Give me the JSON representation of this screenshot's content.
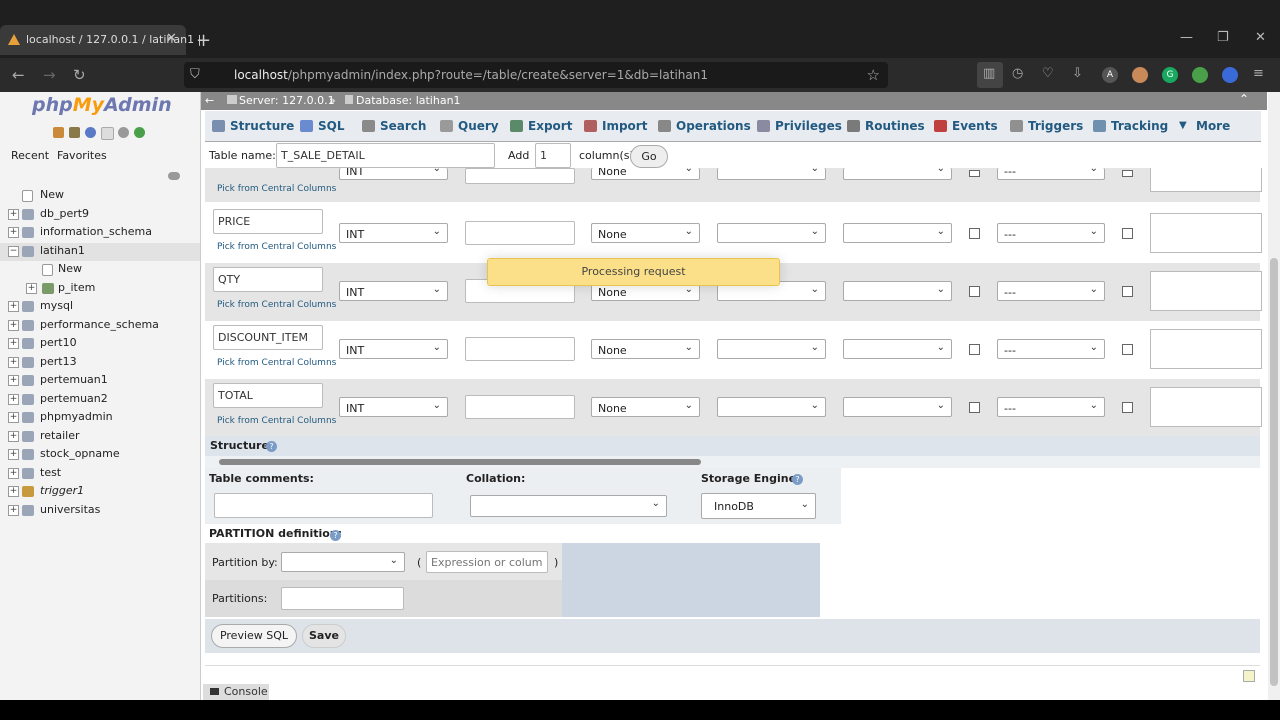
{
  "browser": {
    "tab_title": "localhost / 127.0.0.1 / latihan1 |",
    "url_host": "localhost",
    "url_path": "/phpmyadmin/index.php?route=/table/create&server=1&db=latihan1",
    "extensions": [
      "A",
      "G"
    ]
  },
  "sidebar": {
    "logo_php": "php",
    "logo_my": "My",
    "logo_admin": "Admin",
    "recent": "Recent",
    "favorites": "Favorites",
    "tree": [
      {
        "label": "New",
        "type": "new"
      },
      {
        "label": "db_pert9",
        "type": "db"
      },
      {
        "label": "information_schema",
        "type": "db"
      },
      {
        "label": "latihan1",
        "type": "db",
        "selected": true
      },
      {
        "label": "New",
        "type": "child-new"
      },
      {
        "label": "p_item",
        "type": "child-table"
      },
      {
        "label": "mysql",
        "type": "db"
      },
      {
        "label": "performance_schema",
        "type": "db"
      },
      {
        "label": "pert10",
        "type": "db"
      },
      {
        "label": "pert13",
        "type": "db"
      },
      {
        "label": "pertemuan1",
        "type": "db"
      },
      {
        "label": "pertemuan2",
        "type": "db"
      },
      {
        "label": "phpmyadmin",
        "type": "db"
      },
      {
        "label": "retailer",
        "type": "db"
      },
      {
        "label": "stock_opname",
        "type": "db"
      },
      {
        "label": "test",
        "type": "db"
      },
      {
        "label": "trigger1",
        "type": "db",
        "italic": true
      },
      {
        "label": "universitas",
        "type": "db"
      }
    ]
  },
  "breadcrumb": {
    "server": "Server: 127.0.0.1",
    "sep": "»",
    "database": "Database: latihan1"
  },
  "menu": [
    {
      "label": "Structure",
      "icon": "structure-icon",
      "color": "#7a8fb0"
    },
    {
      "label": "SQL",
      "icon": "sql-icon",
      "color": "#6a8bd0"
    },
    {
      "label": "Search",
      "icon": "search-icon",
      "color": "#8a8a8a"
    },
    {
      "label": "Query",
      "icon": "query-icon",
      "color": "#9a9a9a"
    },
    {
      "label": "Export",
      "icon": "export-icon",
      "color": "#5b8a6a"
    },
    {
      "label": "Import",
      "icon": "import-icon",
      "color": "#b06060"
    },
    {
      "label": "Operations",
      "icon": "wrench-icon",
      "color": "#888888"
    },
    {
      "label": "Privileges",
      "icon": "privileges-icon",
      "color": "#8a8aa0"
    },
    {
      "label": "Routines",
      "icon": "routines-icon",
      "color": "#7a7a7a"
    },
    {
      "label": "Events",
      "icon": "events-icon",
      "color": "#c04040"
    },
    {
      "label": "Triggers",
      "icon": "triggers-icon",
      "color": "#909090"
    },
    {
      "label": "Tracking",
      "icon": "tracking-icon",
      "color": "#7090b0"
    },
    {
      "label": "More",
      "icon": "chevron-down-icon",
      "color": "#235a81"
    }
  ],
  "table_form": {
    "name_label": "Table name:",
    "name_value": "T_SALE_DETAIL",
    "add_label": "Add",
    "add_value": "1",
    "columns_label": "column(s)",
    "go_label": "Go"
  },
  "columns": [
    {
      "name": "",
      "type": "INT",
      "default": "None",
      "index": "---"
    },
    {
      "name": "PRICE",
      "type": "INT",
      "default": "None",
      "index": "---"
    },
    {
      "name": "QTY",
      "type": "INT",
      "default": "None",
      "index": "---"
    },
    {
      "name": "DISCOUNT_ITEM",
      "type": "INT",
      "default": "None",
      "index": "---"
    },
    {
      "name": "TOTAL",
      "type": "INT",
      "default": "None",
      "index": "---"
    }
  ],
  "pick_central": "Pick from Central Columns",
  "toast": "Processing request",
  "structure_heading": "Structure",
  "table_comments_label": "Table comments:",
  "collation_label": "Collation:",
  "storage_engine_label": "Storage Engine:",
  "storage_engine_value": "InnoDB",
  "partition": {
    "heading": "PARTITION definition:",
    "by_label": "Partition by:",
    "open_paren": "(",
    "close_paren": ")",
    "expr_placeholder": "Expression or column list",
    "partitions_label": "Partitions:"
  },
  "buttons": {
    "preview_sql": "Preview SQL",
    "save": "Save"
  },
  "console": "Console"
}
